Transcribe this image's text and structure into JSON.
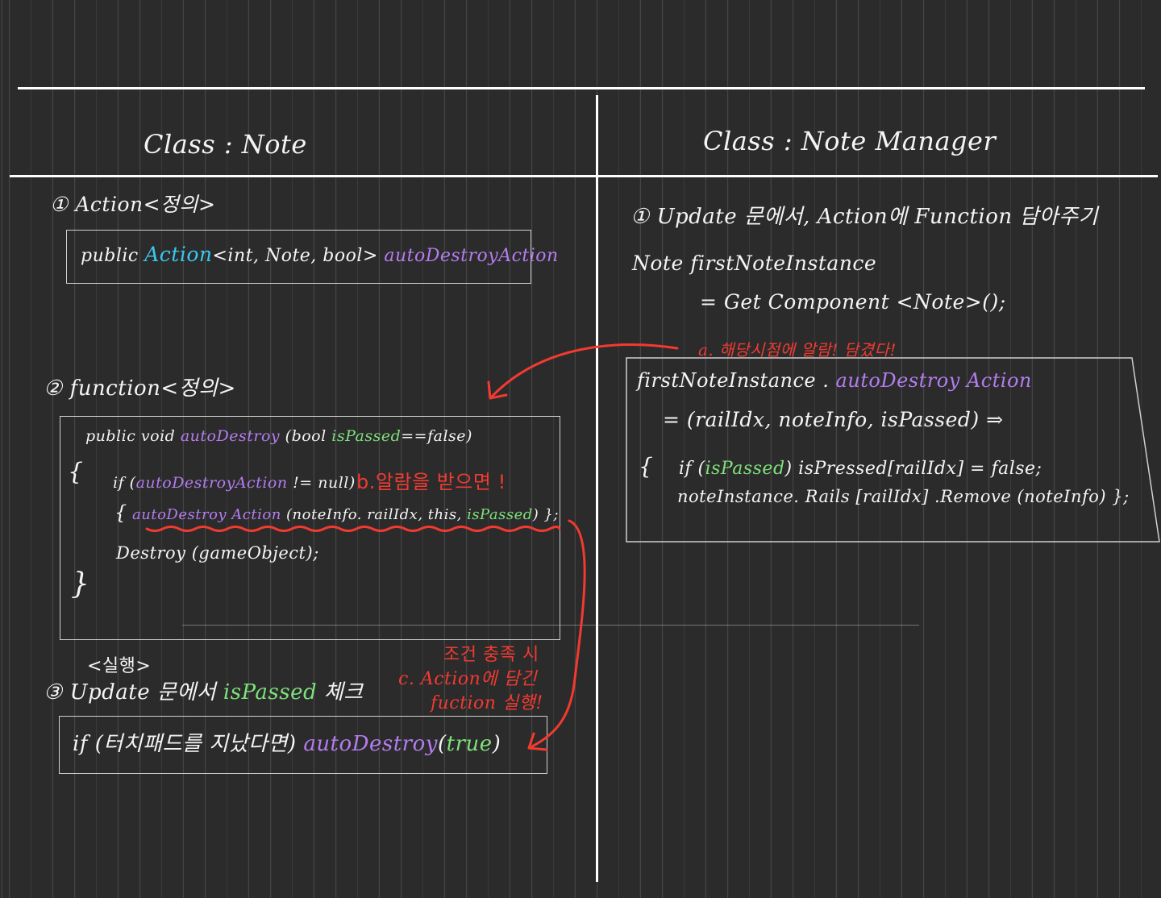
{
  "left": {
    "title": "Class : Note",
    "step1": {
      "heading": "① Action<정의>",
      "code": {
        "kw": "public",
        "type": "Action",
        "generic": "<int, Note, bool>",
        "name": "autoDestroyAction"
      }
    },
    "step2": {
      "heading": "② function<정의>",
      "line1": {
        "kw": "public void",
        "name": "autoDestroy",
        "open": "(bool",
        "param": "isPassed",
        "rest": "==false)"
      },
      "brace_open": "{",
      "line2": {
        "pre": "if (",
        "name": "autoDestroyAction",
        "rest": "!= null)"
      },
      "note_b": "b.알람을 받으면 !",
      "line3": {
        "brace": "{",
        "name": "autoDestroy Action",
        "mid": "(noteInfo. railIdx, this,",
        "param": "isPassed",
        "end": ") };"
      },
      "line4": "Destroy (gameObject);",
      "brace_close": "}"
    },
    "step3": {
      "exec": "<실행>",
      "heading_pre": "③ Update 문에서",
      "heading_param": "isPassed",
      "heading_post": "체크",
      "note_c": [
        "조건 충족 시",
        "c. Action에 담긴",
        "fuction 실행!"
      ],
      "code": {
        "pre": "if (터치패드를 지났다면)",
        "name": "autoDestroy",
        "open": "(",
        "arg": "true",
        "close": ")"
      }
    }
  },
  "right": {
    "title": "Class : Note Manager",
    "heading": {
      "pre": "① Update 문에서, Action에 Function 담아주기"
    },
    "line1": "Note   firstNoteInstance",
    "line2": "= Get Component <Note>();",
    "note_a": "a. 해당시점에 알람! 담겼다!",
    "box": {
      "l1_obj": "firstNoteInstance .",
      "l1_name": "autoDestroy Action",
      "l2": "= (railIdx, noteInfo, isPassed) ⇒",
      "l3_brace": "{",
      "l3_pre": "if (",
      "l3_param": "isPassed",
      "l3_post": ") isPressed[railIdx] = false;",
      "l4": "noteInstance. Rails [railIdx] .Remove (noteInfo) };"
    }
  },
  "colors": {
    "background": "#2b2b2b",
    "cyan": "#39c8f0",
    "purple": "#b57cf0",
    "green": "#7ee07c",
    "red": "#f23a30"
  }
}
